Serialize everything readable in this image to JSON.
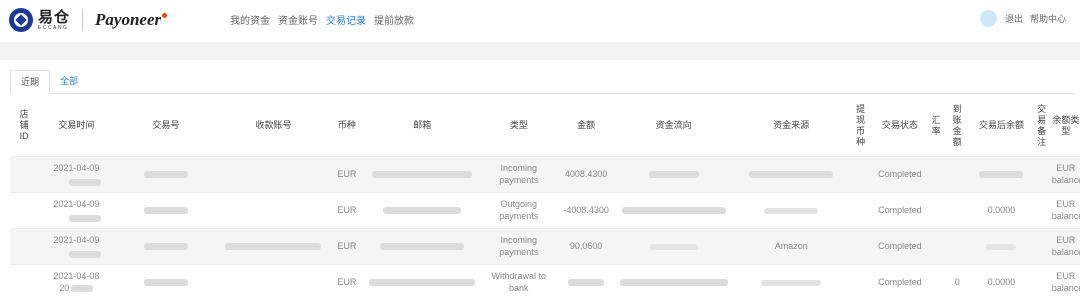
{
  "brand": {
    "cn": "易仓",
    "en": "ECCANG",
    "partner": "Payoneer"
  },
  "nav": {
    "items": [
      {
        "label": "我的资金",
        "active": false
      },
      {
        "label": "资金账号",
        "active": false
      },
      {
        "label": "交易记录",
        "active": true
      },
      {
        "label": "提前放款",
        "active": false
      }
    ]
  },
  "header_right": {
    "logout": "退出",
    "help": "帮助中心"
  },
  "tabs": [
    {
      "label": "近期",
      "active": true
    },
    {
      "label": "全部",
      "active": false
    }
  ],
  "table": {
    "headers": {
      "store_id": "店铺ID",
      "time": "交易时间",
      "txn_no": "交易号",
      "account": "收款账号",
      "currency": "币种",
      "email": "邮箱",
      "type": "类型",
      "amount": "金额",
      "flow": "资金流向",
      "source": "资金来源",
      "withdraw_currency": "提现币种",
      "status": "交易状态",
      "rate": "汇率",
      "arrived": "到账金额",
      "balance_after": "交易后余额",
      "remark": "交易备注",
      "balance_type": "余额类型"
    },
    "rows": [
      {
        "date": "2021-04-09",
        "currency": "EUR",
        "type": "Incoming payments",
        "amount": "4008.4300",
        "source": "",
        "status": "Completed",
        "arrived": "",
        "balance_after": "",
        "balance_type": "EUR balance"
      },
      {
        "date": "2021-04-09",
        "currency": "EUR",
        "type": "Outgoing payments",
        "amount": "-4008.4300",
        "source": "",
        "status": "Completed",
        "arrived": "",
        "balance_after": "0.0000",
        "balance_type": "EUR balance"
      },
      {
        "date": "2021-04-09",
        "currency": "EUR",
        "type": "Incoming payments",
        "amount": "90.0600",
        "source": "Amazon",
        "status": "Completed",
        "arrived": "",
        "balance_after": "",
        "balance_type": "EUR balance"
      },
      {
        "date": "2021-04-08",
        "date_suffix": "20",
        "currency": "EUR",
        "type": "Withdrawal to bank",
        "amount": "",
        "source": "",
        "status": "Completed",
        "arrived": "0",
        "balance_after": "0.0000",
        "balance_type": "EUR balance"
      }
    ]
  }
}
